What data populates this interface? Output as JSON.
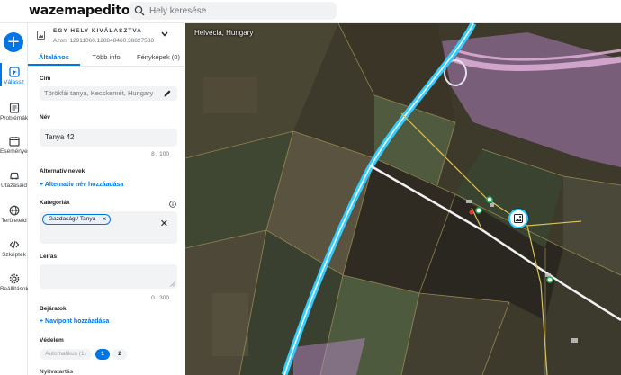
{
  "app": {
    "logo": "wazemapeditor"
  },
  "search": {
    "placeholder": "Hely keresése"
  },
  "rail": {
    "items": [
      {
        "label": "Válassz"
      },
      {
        "label": "Problémák"
      },
      {
        "label": "Események"
      },
      {
        "label": "Utazásaid"
      },
      {
        "label": "Területeid"
      },
      {
        "label": "Szkriptek"
      },
      {
        "label": "Beállítások"
      }
    ]
  },
  "panel": {
    "header_title": "EGY HELY KIVÁLASZTVA",
    "header_id": "Azon: 12911060.128848460.38827588",
    "tabs": [
      {
        "label": "Általános"
      },
      {
        "label": "Több info"
      },
      {
        "label": "Fényképek (0)"
      }
    ],
    "address_label": "Cím",
    "address_value": "Törökfái tanya, Kecskemét, Hungary",
    "name_label": "Név",
    "name_value": "Tanya 42",
    "name_counter": "8 / 100",
    "alt_names_label": "Alternatív nevek",
    "alt_names_add": "+ Alternatív név hozzáadása",
    "categories_label": "Kategóriák",
    "category_chip": "Gazdaság / Tanya",
    "description_label": "Leírás",
    "description_counter": "0 / 300",
    "entrances_label": "Bejáratok",
    "entrances_add": "+ Navipont hozzáadása",
    "protection_label": "Védelem",
    "protection_options": [
      {
        "label": "Automatikus (1)"
      },
      {
        "label": "1"
      },
      {
        "label": "2"
      }
    ],
    "cut_label": "Nyitvatartás"
  },
  "map": {
    "location_label": "Helvécia, Hungary"
  },
  "colors": {
    "accent": "#0075e3",
    "road_highlight": "#33ccff",
    "area_tint": "#c48bd6"
  }
}
